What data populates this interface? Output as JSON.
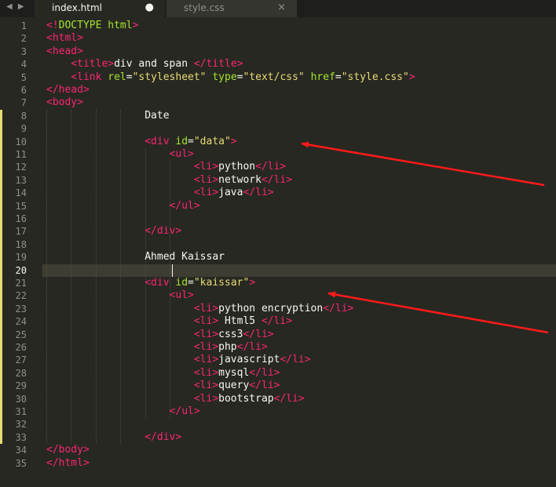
{
  "tabs": [
    {
      "label": "index.html",
      "active": true,
      "indicator": "●"
    },
    {
      "label": "style.css",
      "active": false,
      "indicator": "×"
    }
  ],
  "nav_arrows": "◀ ▶",
  "colors": {
    "background": "#272822",
    "tag": "#f92672",
    "attribute": "#a6e22e",
    "string": "#e6db74",
    "text": "#f8f8f2",
    "annotation_arrow": "#ff1a1a"
  },
  "editor": {
    "current_line": 20,
    "modified_lines": [
      8,
      33
    ],
    "lines": [
      [
        [
          "tag",
          "<!"
        ],
        [
          "attr",
          "DOCTYPE"
        ],
        [
          "txt",
          " "
        ],
        [
          "attr",
          "html"
        ],
        [
          "tag",
          ">"
        ]
      ],
      [
        [
          "tag",
          "<html>"
        ]
      ],
      [
        [
          "tag",
          "<head>"
        ]
      ],
      [
        [
          "txt",
          "    "
        ],
        [
          "tag",
          "<title>"
        ],
        [
          "txt",
          "div and span "
        ],
        [
          "tag",
          "</title>"
        ]
      ],
      [
        [
          "txt",
          "    "
        ],
        [
          "tag",
          "<link "
        ],
        [
          "attr",
          "rel"
        ],
        [
          "txt",
          "="
        ],
        [
          "str",
          "\"stylesheet\""
        ],
        [
          "txt",
          " "
        ],
        [
          "attr",
          "type"
        ],
        [
          "txt",
          "="
        ],
        [
          "str",
          "\"text/css\""
        ],
        [
          "txt",
          " "
        ],
        [
          "attr",
          "href"
        ],
        [
          "txt",
          "="
        ],
        [
          "str",
          "\"style.css\""
        ],
        [
          "tag",
          ">"
        ]
      ],
      [
        [
          "tag",
          "</head>"
        ]
      ],
      [
        [
          "tag",
          "<body>"
        ]
      ],
      [
        [
          "txt",
          "                Date"
        ]
      ],
      [],
      [
        [
          "txt",
          "                "
        ],
        [
          "tag",
          "<div "
        ],
        [
          "attr",
          "id"
        ],
        [
          "txt",
          "="
        ],
        [
          "str",
          "\"data\""
        ],
        [
          "tag",
          ">"
        ]
      ],
      [
        [
          "txt",
          "                    "
        ],
        [
          "tag",
          "<ul>"
        ]
      ],
      [
        [
          "txt",
          "                        "
        ],
        [
          "tag",
          "<li>"
        ],
        [
          "txt",
          "python"
        ],
        [
          "tag",
          "</li>"
        ]
      ],
      [
        [
          "txt",
          "                        "
        ],
        [
          "tag",
          "<li>"
        ],
        [
          "txt",
          "network"
        ],
        [
          "tag",
          "</li>"
        ]
      ],
      [
        [
          "txt",
          "                        "
        ],
        [
          "tag",
          "<li>"
        ],
        [
          "txt",
          "java"
        ],
        [
          "tag",
          "</li>"
        ]
      ],
      [
        [
          "txt",
          "                    "
        ],
        [
          "tag",
          "</ul>"
        ]
      ],
      [],
      [
        [
          "txt",
          "                "
        ],
        [
          "tag",
          "</div>"
        ]
      ],
      [],
      [
        [
          "txt",
          "                Ahmed Kaissar"
        ]
      ],
      [],
      [
        [
          "txt",
          "                "
        ],
        [
          "tag",
          "<div "
        ],
        [
          "attr",
          "id"
        ],
        [
          "txt",
          "="
        ],
        [
          "str",
          "\"kaissar\""
        ],
        [
          "tag",
          ">"
        ]
      ],
      [
        [
          "txt",
          "                    "
        ],
        [
          "tag",
          "<ul>"
        ]
      ],
      [
        [
          "txt",
          "                        "
        ],
        [
          "tag",
          "<li>"
        ],
        [
          "txt",
          "python encryption"
        ],
        [
          "tag",
          "</li>"
        ]
      ],
      [
        [
          "txt",
          "                        "
        ],
        [
          "tag",
          "<li>"
        ],
        [
          "txt",
          " Html5 "
        ],
        [
          "tag",
          "</li>"
        ]
      ],
      [
        [
          "txt",
          "                        "
        ],
        [
          "tag",
          "<li>"
        ],
        [
          "txt",
          "css3"
        ],
        [
          "tag",
          "</li>"
        ]
      ],
      [
        [
          "txt",
          "                        "
        ],
        [
          "tag",
          "<li>"
        ],
        [
          "txt",
          "php"
        ],
        [
          "tag",
          "</li>"
        ]
      ],
      [
        [
          "txt",
          "                        "
        ],
        [
          "tag",
          "<li>"
        ],
        [
          "txt",
          "javascript"
        ],
        [
          "tag",
          "</li>"
        ]
      ],
      [
        [
          "txt",
          "                        "
        ],
        [
          "tag",
          "<li>"
        ],
        [
          "txt",
          "mysql"
        ],
        [
          "tag",
          "</li>"
        ]
      ],
      [
        [
          "txt",
          "                        "
        ],
        [
          "tag",
          "<li>"
        ],
        [
          "txt",
          "query"
        ],
        [
          "tag",
          "</li>"
        ]
      ],
      [
        [
          "txt",
          "                        "
        ],
        [
          "tag",
          "<li>"
        ],
        [
          "txt",
          "bootstrap"
        ],
        [
          "tag",
          "</li>"
        ]
      ],
      [
        [
          "txt",
          "                    "
        ],
        [
          "tag",
          "</ul>"
        ]
      ],
      [],
      [
        [
          "txt",
          "                "
        ],
        [
          "tag",
          "</div>"
        ]
      ],
      [
        [
          "tag",
          "</body>"
        ]
      ],
      [
        [
          "tag",
          "</html>"
        ]
      ]
    ]
  }
}
